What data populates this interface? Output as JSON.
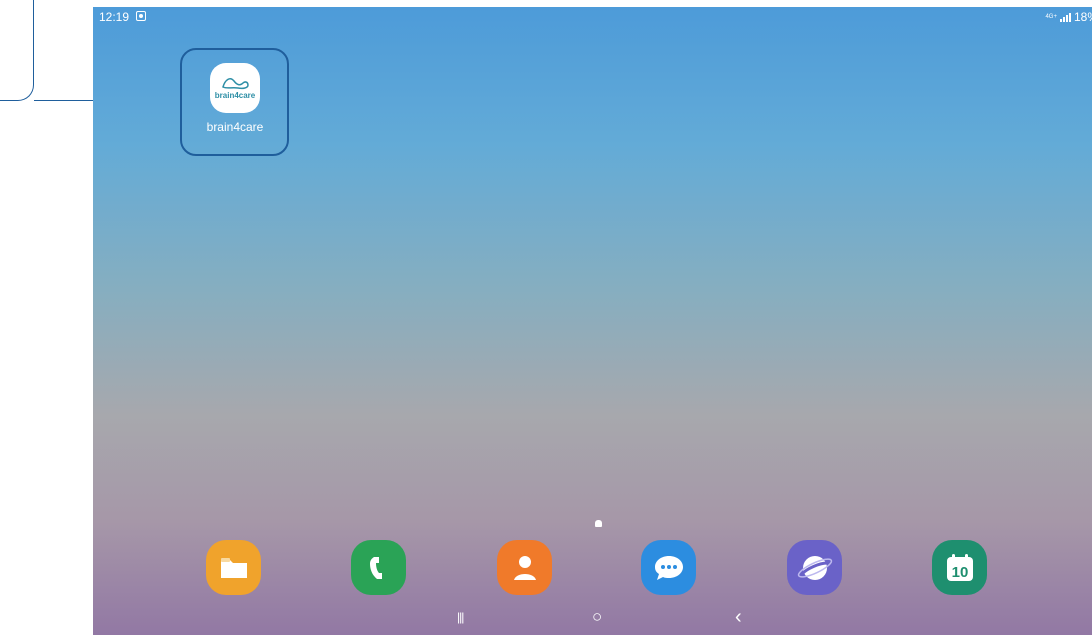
{
  "status_bar": {
    "time": "12:19",
    "network": "4G+",
    "battery": "18%"
  },
  "home": {
    "app": {
      "name": "brain4care",
      "logo_text": "brain4care"
    }
  },
  "dock": [
    {
      "name": "My Files",
      "icon": "folder-icon",
      "color": "#f0a32c"
    },
    {
      "name": "Phone",
      "icon": "phone-icon",
      "color": "#2aa356"
    },
    {
      "name": "Contacts",
      "icon": "contact-icon",
      "color": "#f07a2a"
    },
    {
      "name": "Messages",
      "icon": "chat-bubble-icon",
      "color": "#2c8de0"
    },
    {
      "name": "Internet",
      "icon": "planet-icon",
      "color": "#6a62c8"
    },
    {
      "name": "Calendar",
      "icon": "calendar-icon",
      "color": "#1e8f6f",
      "day": "10"
    }
  ],
  "nav_bar": {
    "recents": "|||",
    "home": "○",
    "back": "‹"
  }
}
